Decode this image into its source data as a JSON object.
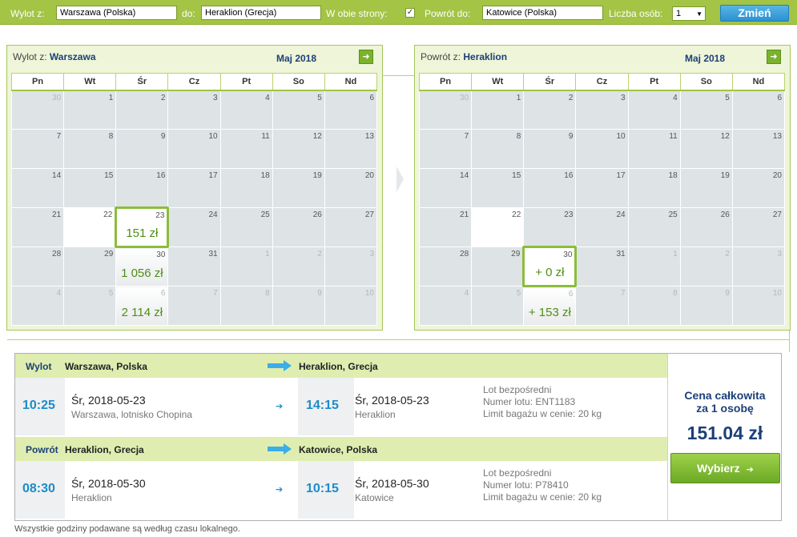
{
  "search": {
    "from_label": "Wylot z:",
    "from_value": "Warszawa (Polska)",
    "to_label": "do:",
    "to_value": "Heraklion (Grecja)",
    "roundtrip_label": "W obie strony:",
    "roundtrip_checked": "✓",
    "return_label": "Powrót do:",
    "return_value": "Katowice (Polska)",
    "persons_label": "Liczba osób:",
    "persons_value": "1",
    "change_button": "Zmień"
  },
  "weekdays": [
    "Pn",
    "Wt",
    "Śr",
    "Cz",
    "Pt",
    "So",
    "Nd"
  ],
  "outbound_calendar": {
    "title_prefix": "Wylot z:",
    "city": "Warszawa",
    "month": "Maj 2018",
    "weeks": [
      [
        {
          "d": "30",
          "o": true
        },
        {
          "d": "1"
        },
        {
          "d": "2"
        },
        {
          "d": "3"
        },
        {
          "d": "4"
        },
        {
          "d": "5"
        },
        {
          "d": "6"
        }
      ],
      [
        {
          "d": "7"
        },
        {
          "d": "8"
        },
        {
          "d": "9"
        },
        {
          "d": "10"
        },
        {
          "d": "11"
        },
        {
          "d": "12"
        },
        {
          "d": "13"
        }
      ],
      [
        {
          "d": "14"
        },
        {
          "d": "15"
        },
        {
          "d": "16"
        },
        {
          "d": "17"
        },
        {
          "d": "18"
        },
        {
          "d": "19"
        },
        {
          "d": "20"
        }
      ],
      [
        {
          "d": "21"
        },
        {
          "d": "22",
          "w": true
        },
        {
          "d": "23",
          "s": true,
          "p": "151 zł"
        },
        {
          "d": "24"
        },
        {
          "d": "25"
        },
        {
          "d": "26"
        },
        {
          "d": "27"
        }
      ],
      [
        {
          "d": "28"
        },
        {
          "d": "29"
        },
        {
          "d": "30",
          "p": "1 056 zł"
        },
        {
          "d": "31"
        },
        {
          "d": "1",
          "o": true
        },
        {
          "d": "2",
          "o": true
        },
        {
          "d": "3",
          "o": true
        }
      ],
      [
        {
          "d": "4",
          "o": true
        },
        {
          "d": "5",
          "o": true
        },
        {
          "d": "6",
          "o": true,
          "p": "2 114 zł"
        },
        {
          "d": "7",
          "o": true
        },
        {
          "d": "8",
          "o": true
        },
        {
          "d": "9",
          "o": true
        },
        {
          "d": "10",
          "o": true
        }
      ]
    ]
  },
  "return_calendar": {
    "title_prefix": "Powrót z:",
    "city": "Heraklion",
    "month": "Maj 2018",
    "weeks": [
      [
        {
          "d": "30",
          "o": true
        },
        {
          "d": "1"
        },
        {
          "d": "2"
        },
        {
          "d": "3"
        },
        {
          "d": "4"
        },
        {
          "d": "5"
        },
        {
          "d": "6"
        }
      ],
      [
        {
          "d": "7"
        },
        {
          "d": "8"
        },
        {
          "d": "9"
        },
        {
          "d": "10"
        },
        {
          "d": "11"
        },
        {
          "d": "12"
        },
        {
          "d": "13"
        }
      ],
      [
        {
          "d": "14"
        },
        {
          "d": "15"
        },
        {
          "d": "16"
        },
        {
          "d": "17"
        },
        {
          "d": "18"
        },
        {
          "d": "19"
        },
        {
          "d": "20"
        }
      ],
      [
        {
          "d": "21"
        },
        {
          "d": "22",
          "w": true
        },
        {
          "d": "23"
        },
        {
          "d": "24"
        },
        {
          "d": "25"
        },
        {
          "d": "26"
        },
        {
          "d": "27"
        }
      ],
      [
        {
          "d": "28"
        },
        {
          "d": "29"
        },
        {
          "d": "30",
          "s": true,
          "p": "+ 0 zł"
        },
        {
          "d": "31"
        },
        {
          "d": "1",
          "o": true
        },
        {
          "d": "2",
          "o": true
        },
        {
          "d": "3",
          "o": true
        }
      ],
      [
        {
          "d": "4",
          "o": true
        },
        {
          "d": "5",
          "o": true
        },
        {
          "d": "6",
          "o": true,
          "p": "+ 153 zł"
        },
        {
          "d": "7",
          "o": true
        },
        {
          "d": "8",
          "o": true
        },
        {
          "d": "9",
          "o": true
        },
        {
          "d": "10",
          "o": true
        }
      ]
    ]
  },
  "outbound": {
    "label": "Wylot",
    "from": "Warszawa, Polska",
    "to": "Heraklion, Grecja",
    "dep_time": "10:25",
    "dep_date": "Śr, 2018-05-23",
    "dep_place": "Warszawa, lotnisko Chopina",
    "arr_time": "14:15",
    "arr_date": "Śr, 2018-05-23",
    "arr_place": "Heraklion",
    "info1": "Lot bezpośredni",
    "info2": "Numer lotu: ENT1183",
    "info3": "Limit bagażu w cenie: 20 kg"
  },
  "return": {
    "label": "Powrót",
    "from": "Heraklion, Grecja",
    "to": "Katowice, Polska",
    "dep_time": "08:30",
    "dep_date": "Śr, 2018-05-30",
    "dep_place": "Heraklion",
    "arr_time": "10:15",
    "arr_date": "Śr, 2018-05-30",
    "arr_place": "Katowice",
    "info1": "Lot bezpośredni",
    "info2": "Numer lotu: P78410",
    "info3": "Limit bagażu w cenie: 20 kg"
  },
  "pricing": {
    "label_line1": "Cena całkowita",
    "label_line2": "za 1 osobę",
    "total": "151.04 zł",
    "select_button": "Wybierz"
  },
  "footer_note": "Wszystkie godziny podawane są według czasu lokalnego.",
  "colors": {
    "search_bar": "#a3c445",
    "accent_blue": "#1e8bc8",
    "price_green": "#4f8f14",
    "title_navy": "#1c3f78"
  }
}
